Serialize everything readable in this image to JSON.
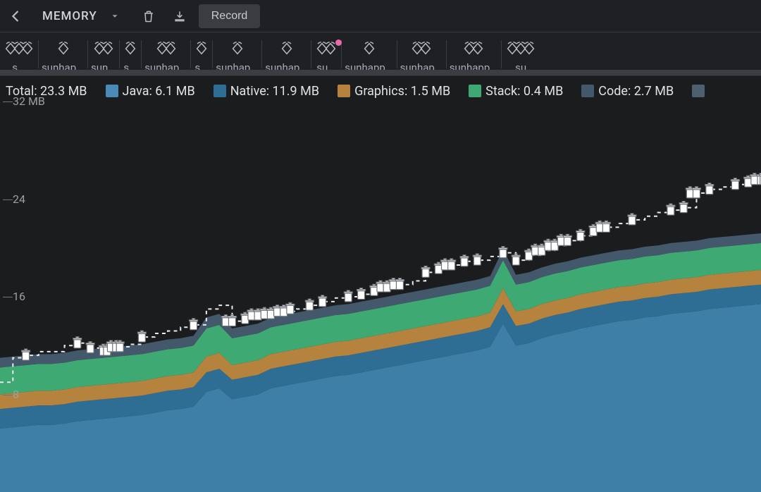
{
  "toolbar": {
    "dropdown_label": "MEMORY",
    "record_label": "Record"
  },
  "sessions": [
    {
      "label": "s...",
      "icons": 3
    },
    {
      "label": "sunhap...",
      "icons": 1
    },
    {
      "label": "sun...",
      "icons": 2
    },
    {
      "label": "s...",
      "icons": 1
    },
    {
      "label": "sunhap...",
      "icons": 2
    },
    {
      "label": "s...",
      "icons": 1
    },
    {
      "label": "sunhap...",
      "icons": 1
    },
    {
      "label": "sunhap...",
      "icons": 1
    },
    {
      "label": "su...",
      "icons": 2,
      "badge": true
    },
    {
      "label": "sunhapp...",
      "icons": 1
    },
    {
      "label": "sunhap...",
      "icons": 2
    },
    {
      "label": "sunhapp...",
      "icons": 2
    },
    {
      "label": "su",
      "icons": 3
    }
  ],
  "legend": {
    "total_label": "Total: 23.3 MB",
    "overlay": "MEMORY",
    "items": [
      {
        "name": "Java",
        "value": "6.1 MB",
        "color": "#4a89b5"
      },
      {
        "name": "Native",
        "value": "11.9 MB",
        "color": "#2e6e95"
      },
      {
        "name": "Graphics",
        "value": "1.5 MB",
        "color": "#b5833e"
      },
      {
        "name": "Stack",
        "value": "0.4 MB",
        "color": "#3fa973"
      },
      {
        "name": "Code",
        "value": "2.7 MB",
        "color": "#43586b"
      }
    ]
  },
  "y_axis": {
    "ticks": [
      "32 MB",
      "24",
      "16",
      "8"
    ]
  },
  "chart_data": {
    "type": "area",
    "ylabel": "MB",
    "ylim": [
      0,
      32
    ],
    "x_count": 60,
    "series": [
      {
        "name": "Java",
        "color": "#3e7fa8",
        "values": [
          5.2,
          5.3,
          5.4,
          5.5,
          5.5,
          5.6,
          5.8,
          5.9,
          6.0,
          6.1,
          6.2,
          6.3,
          6.5,
          6.7,
          6.8,
          7.0,
          8.2,
          8.5,
          7.6,
          7.8,
          8.0,
          8.5,
          8.7,
          8.9,
          9.1,
          9.3,
          9.5,
          9.6,
          9.8,
          10.0,
          10.2,
          10.4,
          10.6,
          10.8,
          11.0,
          11.2,
          11.4,
          11.6,
          11.9,
          13.8,
          12.0,
          12.2,
          12.6,
          12.9,
          13.1,
          13.4,
          13.6,
          13.8,
          14.0,
          14.1,
          14.3,
          14.4,
          14.6,
          14.7,
          14.8,
          15.0,
          15.1,
          15.2,
          15.3,
          15.4
        ]
      },
      {
        "name": "Native",
        "color": "#2e6e95",
        "values": [
          1.6,
          1.6,
          1.6,
          1.6,
          1.6,
          1.6,
          1.6,
          1.6,
          1.6,
          1.6,
          1.6,
          1.6,
          1.6,
          1.6,
          1.6,
          1.6,
          1.6,
          1.6,
          1.6,
          1.6,
          1.6,
          1.6,
          1.6,
          1.6,
          1.6,
          1.6,
          1.6,
          1.6,
          1.6,
          1.6,
          1.6,
          1.6,
          1.6,
          1.6,
          1.6,
          1.6,
          1.6,
          1.6,
          1.6,
          1.6,
          1.6,
          1.6,
          1.6,
          1.6,
          1.6,
          1.6,
          1.6,
          1.6,
          1.6,
          1.6,
          1.6,
          1.6,
          1.6,
          1.6,
          1.6,
          1.6,
          1.6,
          1.6,
          1.6,
          1.6
        ]
      },
      {
        "name": "Graphics",
        "color": "#b5833e",
        "values": [
          1.2,
          1.2,
          1.2,
          1.2,
          1.2,
          1.2,
          1.2,
          1.2,
          1.2,
          1.2,
          1.2,
          1.2,
          1.2,
          1.2,
          1.2,
          1.2,
          1.3,
          1.3,
          1.2,
          1.2,
          1.2,
          1.2,
          1.2,
          1.2,
          1.2,
          1.2,
          1.2,
          1.2,
          1.2,
          1.2,
          1.2,
          1.2,
          1.2,
          1.2,
          1.2,
          1.2,
          1.2,
          1.2,
          1.2,
          1.3,
          1.2,
          1.2,
          1.2,
          1.2,
          1.2,
          1.2,
          1.2,
          1.2,
          1.2,
          1.2,
          1.2,
          1.2,
          1.2,
          1.2,
          1.2,
          1.2,
          1.2,
          1.2,
          1.2,
          1.2
        ]
      },
      {
        "name": "Stack",
        "color": "#3fa973",
        "values": [
          2.2,
          2.2,
          2.2,
          2.2,
          2.2,
          2.2,
          2.2,
          2.2,
          2.2,
          2.2,
          2.2,
          2.2,
          2.2,
          2.2,
          2.2,
          2.2,
          2.3,
          2.3,
          2.2,
          2.2,
          2.2,
          2.2,
          2.2,
          2.2,
          2.2,
          2.2,
          2.2,
          2.2,
          2.2,
          2.2,
          2.2,
          2.2,
          2.2,
          2.2,
          2.2,
          2.2,
          2.2,
          2.2,
          2.2,
          2.3,
          2.2,
          2.2,
          2.2,
          2.2,
          2.2,
          2.2,
          2.2,
          2.2,
          2.2,
          2.2,
          2.2,
          2.2,
          2.2,
          2.2,
          2.2,
          2.2,
          2.2,
          2.2,
          2.2,
          2.2
        ]
      },
      {
        "name": "Code",
        "color": "#43586b",
        "values": [
          0.8,
          0.8,
          0.8,
          0.8,
          0.8,
          0.8,
          0.8,
          0.8,
          0.8,
          0.8,
          0.8,
          0.8,
          0.8,
          0.8,
          0.8,
          0.8,
          0.9,
          0.9,
          0.8,
          0.8,
          0.8,
          0.8,
          0.8,
          0.8,
          0.8,
          0.8,
          0.8,
          0.8,
          0.8,
          0.8,
          0.8,
          0.8,
          0.8,
          0.8,
          0.8,
          0.8,
          0.8,
          0.8,
          0.8,
          0.9,
          0.8,
          0.8,
          0.8,
          0.8,
          0.8,
          0.8,
          0.8,
          0.8,
          0.8,
          0.8,
          0.8,
          0.8,
          0.8,
          0.8,
          0.8,
          0.8,
          0.8,
          0.8,
          0.8,
          0.8
        ]
      }
    ],
    "total_line": [
      9.0,
      11.0,
      11.2,
      11.5,
      11.5,
      12.0,
      12.2,
      11.8,
      11.6,
      11.9,
      12.1,
      12.7,
      13.0,
      13.2,
      13.5,
      13.7,
      15.0,
      15.3,
      14.0,
      14.2,
      14.5,
      14.6,
      14.8,
      15.0,
      15.3,
      15.6,
      15.9,
      16.0,
      16.2,
      16.5,
      16.8,
      17.0,
      17.3,
      18.0,
      18.3,
      18.6,
      18.9,
      19.0,
      19.3,
      19.6,
      19.0,
      19.4,
      19.8,
      20.2,
      20.6,
      21.0,
      21.4,
      21.7,
      22.0,
      22.3,
      22.6,
      22.9,
      23.1,
      23.3,
      24.5,
      24.8,
      25.0,
      25.2,
      25.4,
      25.6
    ],
    "gc_events_x": [
      2,
      6,
      7,
      8,
      8.3,
      8.6,
      9,
      9.3,
      11,
      15,
      17.5,
      18,
      19,
      19.5,
      20,
      20.5,
      21,
      21.5,
      22,
      22.5,
      24,
      25,
      27,
      28,
      29,
      29.5,
      30,
      30.5,
      31,
      33,
      34,
      34.5,
      35,
      36,
      37,
      39,
      40,
      41,
      41.5,
      42,
      42.5,
      43,
      43.5,
      44,
      45,
      46,
      46.5,
      47,
      49,
      52,
      53,
      53.5,
      54,
      55,
      57,
      58,
      58.5,
      59,
      59.2,
      59.5
    ]
  }
}
